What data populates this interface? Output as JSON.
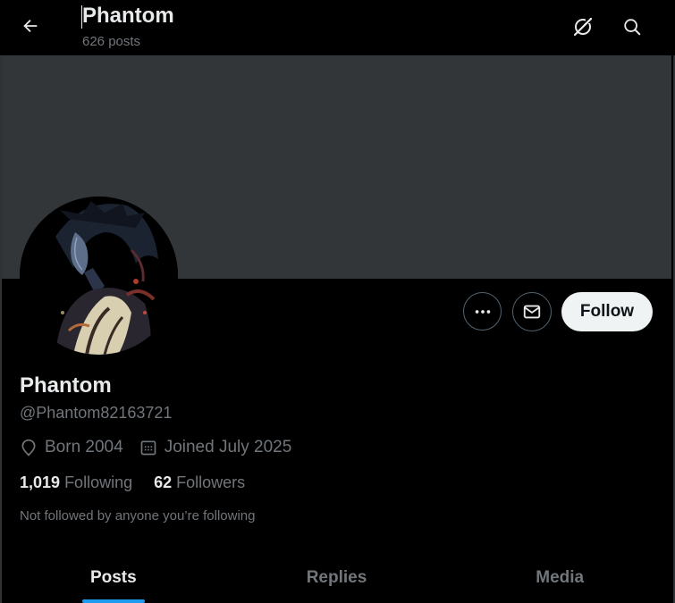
{
  "header": {
    "title": "Phantom",
    "post_count": "626 posts"
  },
  "profile": {
    "name": "Phantom",
    "handle": "@Phantom82163721",
    "born": "Born 2004",
    "joined": "Joined July 2025",
    "following_count": "1,019",
    "following_label": "Following",
    "followers_count": "62",
    "followers_label": "Followers",
    "context": "Not followed by anyone you’re following"
  },
  "actions": {
    "follow_label": "Follow"
  },
  "tabs": [
    {
      "label": "Posts",
      "active": true
    },
    {
      "label": "Replies",
      "active": false
    },
    {
      "label": "Media",
      "active": false
    }
  ],
  "colors": {
    "background": "#000000",
    "banner": "#333639",
    "accent": "#1d9bf0",
    "text_primary": "#e7e9ea",
    "text_secondary": "#71767b"
  },
  "icons": [
    "back-arrow-icon",
    "grok-icon",
    "search-icon",
    "more-icon",
    "mail-icon",
    "location-icon",
    "calendar-icon"
  ]
}
